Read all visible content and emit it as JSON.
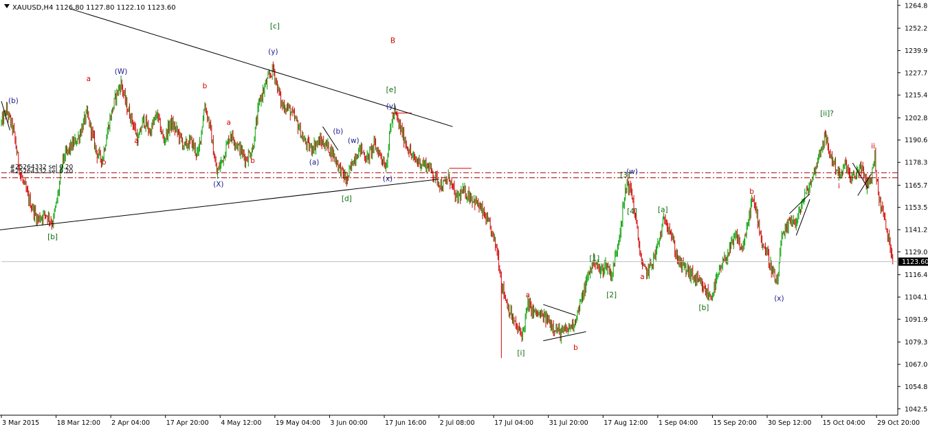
{
  "chart_data": {
    "type": "candlestick",
    "header": "XAUUSD,H4  1126.80 1127.80 1122.10 1123.60",
    "symbol": "XAUUSD,H4",
    "ohlc_header": {
      "open": 1126.8,
      "high": 1127.8,
      "low": 1122.1,
      "close": 1123.6
    },
    "current_price": 1123.6,
    "current_price_label": "1123.60",
    "ylim": [
      1039.0,
      1267.0
    ],
    "y_ticks": [
      1264.8,
      1252.2,
      1239.9,
      1227.7,
      1215.4,
      1202.8,
      1190.6,
      1178.3,
      1165.7,
      1153.5,
      1141.2,
      1129.0,
      1116.4,
      1104.1,
      1091.9,
      1079.3,
      1067.0,
      1054.8,
      1042.5
    ],
    "y_tick_labels": [
      "1264.80",
      "1252.20",
      "1239.90",
      "1227.70",
      "1215.40",
      "1202.80",
      "1190.60",
      "1178.30",
      "1165.70",
      "1153.50",
      "1141.20",
      "1129.00",
      "1116.40",
      "1104.10",
      "1091.90",
      "1079.30",
      "1067.00",
      "1054.80",
      "1042.50"
    ],
    "x_ticks": [
      {
        "t": 0,
        "label": "3 Mar 2015"
      },
      {
        "t": 64,
        "label": "18 Mar 12:00"
      },
      {
        "t": 128,
        "label": "2 Apr 04:00"
      },
      {
        "t": 192,
        "label": "17 Apr 20:00"
      },
      {
        "t": 256,
        "label": "4 May 12:00"
      },
      {
        "t": 320,
        "label": "19 May 04:00"
      },
      {
        "t": 384,
        "label": "3 Jun 00:00"
      },
      {
        "t": 448,
        "label": "17 Jun 16:00"
      },
      {
        "t": 512,
        "label": "2 Jul 08:00"
      },
      {
        "t": 576,
        "label": "17 Jul 04:00"
      },
      {
        "t": 640,
        "label": "31 Jul 20:00"
      },
      {
        "t": 704,
        "label": "17 Aug 12:00"
      },
      {
        "t": 768,
        "label": "1 Sep 04:00"
      },
      {
        "t": 832,
        "label": "15 Sep 20:00"
      },
      {
        "t": 896,
        "label": "30 Sep 12:00"
      },
      {
        "t": 960,
        "label": "15 Oct 04:00"
      },
      {
        "t": 1024,
        "label": "29 Oct 20:00"
      }
    ],
    "bar_count": 1044,
    "price_path": [
      [
        0,
        1200
      ],
      [
        6,
        1207
      ],
      [
        14,
        1196
      ],
      [
        22,
        1172
      ],
      [
        32,
        1158
      ],
      [
        42,
        1147
      ],
      [
        52,
        1150
      ],
      [
        60,
        1145
      ],
      [
        66,
        1160
      ],
      [
        72,
        1180
      ],
      [
        80,
        1186
      ],
      [
        90,
        1192
      ],
      [
        100,
        1205
      ],
      [
        104,
        1198
      ],
      [
        112,
        1183
      ],
      [
        118,
        1180
      ],
      [
        126,
        1200
      ],
      [
        134,
        1215
      ],
      [
        140,
        1222
      ],
      [
        146,
        1210
      ],
      [
        154,
        1200
      ],
      [
        160,
        1190
      ],
      [
        166,
        1202
      ],
      [
        174,
        1195
      ],
      [
        182,
        1205
      ],
      [
        190,
        1190
      ],
      [
        198,
        1200
      ],
      [
        206,
        1195
      ],
      [
        214,
        1187
      ],
      [
        222,
        1190
      ],
      [
        230,
        1182
      ],
      [
        238,
        1210
      ],
      [
        244,
        1198
      ],
      [
        252,
        1172
      ],
      [
        260,
        1182
      ],
      [
        268,
        1194
      ],
      [
        276,
        1188
      ],
      [
        286,
        1180
      ],
      [
        294,
        1186
      ],
      [
        302,
        1212
      ],
      [
        310,
        1222
      ],
      [
        318,
        1230
      ],
      [
        322,
        1222
      ],
      [
        328,
        1210
      ],
      [
        336,
        1208
      ],
      [
        346,
        1200
      ],
      [
        354,
        1190
      ],
      [
        362,
        1186
      ],
      [
        372,
        1190
      ],
      [
        380,
        1188
      ],
      [
        388,
        1183
      ],
      [
        396,
        1175
      ],
      [
        404,
        1168
      ],
      [
        412,
        1180
      ],
      [
        420,
        1186
      ],
      [
        428,
        1180
      ],
      [
        436,
        1188
      ],
      [
        444,
        1182
      ],
      [
        450,
        1176
      ],
      [
        456,
        1200
      ],
      [
        460,
        1206
      ],
      [
        466,
        1198
      ],
      [
        474,
        1188
      ],
      [
        482,
        1180
      ],
      [
        492,
        1178
      ],
      [
        500,
        1176
      ],
      [
        508,
        1170
      ],
      [
        516,
        1165
      ],
      [
        524,
        1170
      ],
      [
        532,
        1158
      ],
      [
        540,
        1162
      ],
      [
        548,
        1160
      ],
      [
        556,
        1156
      ],
      [
        564,
        1150
      ],
      [
        572,
        1142
      ],
      [
        580,
        1130
      ],
      [
        586,
        1110
      ],
      [
        592,
        1100
      ],
      [
        598,
        1092
      ],
      [
        604,
        1086
      ],
      [
        610,
        1084
      ],
      [
        616,
        1100
      ],
      [
        622,
        1096
      ],
      [
        630,
        1094
      ],
      [
        638,
        1092
      ],
      [
        646,
        1088
      ],
      [
        654,
        1084
      ],
      [
        662,
        1086
      ],
      [
        670,
        1090
      ],
      [
        676,
        1098
      ],
      [
        682,
        1108
      ],
      [
        688,
        1118
      ],
      [
        694,
        1125
      ],
      [
        700,
        1118
      ],
      [
        708,
        1122
      ],
      [
        714,
        1116
      ],
      [
        720,
        1130
      ],
      [
        726,
        1148
      ],
      [
        732,
        1168
      ],
      [
        738,
        1160
      ],
      [
        744,
        1140
      ],
      [
        750,
        1120
      ],
      [
        756,
        1118
      ],
      [
        764,
        1126
      ],
      [
        770,
        1136
      ],
      [
        776,
        1148
      ],
      [
        782,
        1142
      ],
      [
        788,
        1130
      ],
      [
        794,
        1122
      ],
      [
        800,
        1120
      ],
      [
        808,
        1116
      ],
      [
        816,
        1112
      ],
      [
        822,
        1108
      ],
      [
        830,
        1104
      ],
      [
        836,
        1112
      ],
      [
        842,
        1120
      ],
      [
        848,
        1126
      ],
      [
        854,
        1132
      ],
      [
        860,
        1138
      ],
      [
        866,
        1130
      ],
      [
        872,
        1140
      ],
      [
        878,
        1158
      ],
      [
        884,
        1150
      ],
      [
        890,
        1134
      ],
      [
        896,
        1128
      ],
      [
        902,
        1118
      ],
      [
        908,
        1110
      ],
      [
        912,
        1135
      ],
      [
        918,
        1140
      ],
      [
        924,
        1148
      ],
      [
        930,
        1144
      ],
      [
        936,
        1155
      ],
      [
        942,
        1162
      ],
      [
        948,
        1168
      ],
      [
        954,
        1178
      ],
      [
        960,
        1188
      ],
      [
        964,
        1192
      ],
      [
        970,
        1182
      ],
      [
        976,
        1176
      ],
      [
        982,
        1170
      ],
      [
        988,
        1178
      ],
      [
        994,
        1168
      ],
      [
        1000,
        1172
      ],
      [
        1006,
        1176
      ],
      [
        1012,
        1166
      ],
      [
        1018,
        1170
      ],
      [
        1022,
        1182
      ],
      [
        1026,
        1160
      ],
      [
        1032,
        1150
      ],
      [
        1036,
        1140
      ],
      [
        1040,
        1132
      ],
      [
        1044,
        1124
      ]
    ],
    "trendlines": [
      {
        "points": [
          [
            -4,
            1141
          ],
          [
            512,
            1169
          ]
        ],
        "color": "#000000"
      },
      {
        "points": [
          [
            80,
            1263
          ],
          [
            528,
            1198
          ]
        ],
        "color": "#000000"
      },
      {
        "points": [
          [
            376,
            1198
          ],
          [
            394,
            1185
          ]
        ],
        "color": "#000000"
      },
      {
        "points": [
          [
            634,
            1100
          ],
          [
            672,
            1094
          ]
        ],
        "color": "#000000"
      },
      {
        "points": [
          [
            634,
            1080
          ],
          [
            684,
            1085
          ]
        ],
        "color": "#000000"
      },
      {
        "points": [
          [
            930,
            1138
          ],
          [
            946,
            1158
          ]
        ],
        "color": "#000000"
      },
      {
        "points": [
          [
            922,
            1150
          ],
          [
            946,
            1161
          ]
        ],
        "color": "#000000"
      },
      {
        "points": [
          [
            996,
            1178
          ],
          [
            1014,
            1164
          ]
        ],
        "color": "#000000"
      },
      {
        "points": [
          [
            1002,
            1160
          ],
          [
            1018,
            1172
          ]
        ],
        "color": "#000000"
      },
      {
        "points": [
          [
            0,
            1212
          ],
          [
            10,
            1196
          ]
        ],
        "color": "#000000"
      }
    ],
    "horizontal_lines": [
      {
        "y": 1172.6,
        "style": "dashdot",
        "color": "#a00000"
      },
      {
        "y": 1169.8,
        "style": "dashdot",
        "color": "#a00000"
      },
      {
        "y": 1123.6,
        "style": "solid",
        "color": "#c0c0c0"
      }
    ],
    "short_red_lines": [
      {
        "t1": 456,
        "t2": 480,
        "y": 1205.5
      },
      {
        "t1": 524,
        "t2": 550,
        "y": 1175.0
      }
    ],
    "line_labels": [
      {
        "text": "#25264332 sel 0.20",
        "t": 10,
        "y": 1174.8
      },
      {
        "text": "#25264332 sel 0.20",
        "t": 10,
        "y": 1172.3
      }
    ],
    "wave_labels": [
      {
        "text": "(b)",
        "t": 14,
        "y": 1211,
        "color": "#1a1a8c"
      },
      {
        "text": "[b]",
        "t": 60,
        "y": 1136,
        "color": "#0a6a0a"
      },
      {
        "text": "a",
        "t": 102,
        "y": 1223,
        "color": "#d00000"
      },
      {
        "text": "b",
        "t": 120,
        "y": 1177,
        "color": "#d00000"
      },
      {
        "text": "(W)",
        "t": 140,
        "y": 1227,
        "color": "#1a1a8c"
      },
      {
        "text": "a",
        "t": 158,
        "y": 1189,
        "color": "#d00000"
      },
      {
        "text": "b",
        "t": 238,
        "y": 1219,
        "color": "#d00000"
      },
      {
        "text": "a",
        "t": 266,
        "y": 1199,
        "color": "#d00000"
      },
      {
        "text": "b",
        "t": 294,
        "y": 1178,
        "color": "#d00000"
      },
      {
        "text": "(X)",
        "t": 254,
        "y": 1165,
        "color": "#1a1a8c"
      },
      {
        "text": "[c]",
        "t": 320,
        "y": 1252,
        "color": "#0a6a0a"
      },
      {
        "text": "(y)",
        "t": 318,
        "y": 1238,
        "color": "#1a1a8c"
      },
      {
        "text": "B",
        "t": 458,
        "y": 1244,
        "color": "#d00000"
      },
      {
        "text": "[e]",
        "t": 456,
        "y": 1217,
        "color": "#0a6a0a"
      },
      {
        "text": "(y)",
        "t": 456,
        "y": 1208,
        "color": "#1a1a8c"
      },
      {
        "text": "(b)",
        "t": 394,
        "y": 1194,
        "color": "#1a1a8c"
      },
      {
        "text": "(w)",
        "t": 412,
        "y": 1189,
        "color": "#1a1a8c"
      },
      {
        "text": "(a)",
        "t": 366,
        "y": 1177,
        "color": "#1a1a8c"
      },
      {
        "text": "(x)",
        "t": 452,
        "y": 1168,
        "color": "#1a1a8c"
      },
      {
        "text": "[d]",
        "t": 404,
        "y": 1157,
        "color": "#0a6a0a"
      },
      {
        "text": "a",
        "t": 616,
        "y": 1104,
        "color": "#d00000"
      },
      {
        "text": "b",
        "t": 672,
        "y": 1075,
        "color": "#d00000"
      },
      {
        "text": "[i]",
        "t": 608,
        "y": 1072,
        "color": "#0a6a0a"
      },
      {
        "text": "[1]",
        "t": 694,
        "y": 1124,
        "color": "#0a6a0a"
      },
      {
        "text": "[2]",
        "t": 714,
        "y": 1104,
        "color": "#0a6a0a"
      },
      {
        "text": "[3]",
        "t": 730,
        "y": 1170,
        "color": "#0a6a0a"
      },
      {
        "text": "(w)",
        "t": 738,
        "y": 1172,
        "color": "#1a1a8c"
      },
      {
        "text": "[4]",
        "t": 738,
        "y": 1150,
        "color": "#0a6a0a"
      },
      {
        "text": "a",
        "t": 750,
        "y": 1114,
        "color": "#d00000"
      },
      {
        "text": "[a]",
        "t": 774,
        "y": 1151,
        "color": "#0a6a0a"
      },
      {
        "text": "[b]",
        "t": 822,
        "y": 1097,
        "color": "#0a6a0a"
      },
      {
        "text": "b",
        "t": 878,
        "y": 1161,
        "color": "#d00000"
      },
      {
        "text": "(x)",
        "t": 910,
        "y": 1102,
        "color": "#1a1a8c"
      },
      {
        "text": "[ii]?",
        "t": 966,
        "y": 1204,
        "color": "#0a6a0a"
      },
      {
        "text": "ii",
        "t": 1020,
        "y": 1186,
        "color": "#d00000"
      },
      {
        "text": "i",
        "t": 980,
        "y": 1164,
        "color": "#d00000"
      }
    ],
    "colors": {
      "up": "#00a000",
      "down": "#d00000",
      "axis": "#000000",
      "price_tag_bg": "#000000",
      "price_tag_text": "#ffffff"
    }
  }
}
